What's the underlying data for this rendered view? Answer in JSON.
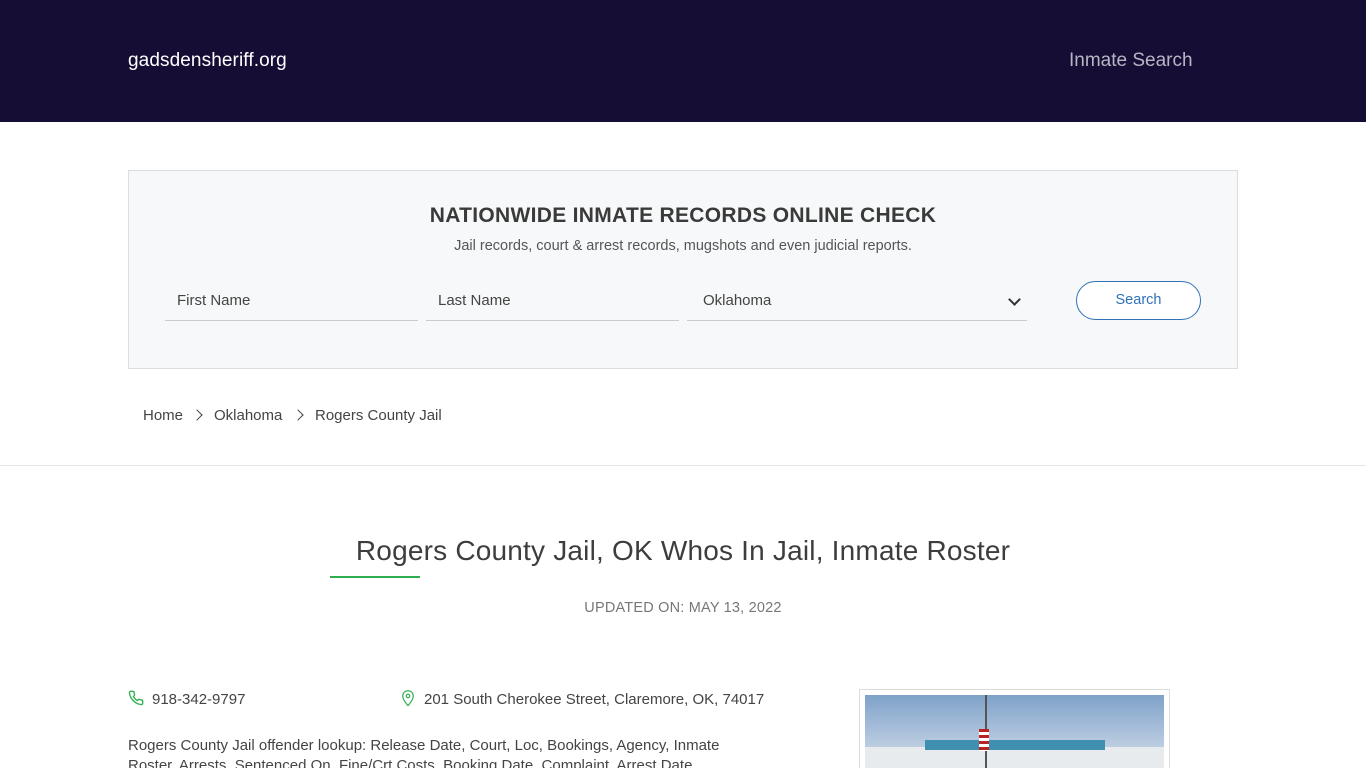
{
  "header": {
    "site_name": "gadsdensheriff.org",
    "nav_link": "Inmate Search",
    "background_color": "#150d34"
  },
  "search_panel": {
    "title": "NATIONWIDE INMATE RECORDS ONLINE CHECK",
    "subtitle": "Jail records, court & arrest records, mugshots and even judicial reports.",
    "first_name_placeholder": "First Name",
    "last_name_placeholder": "Last Name",
    "state_selected": "Oklahoma",
    "search_button": "Search",
    "accent_color": "#2f72b8"
  },
  "breadcrumb": {
    "items": [
      "Home",
      "Oklahoma",
      "Rogers County Jail"
    ]
  },
  "main": {
    "title": "Rogers County Jail, OK Whos In Jail, Inmate Roster",
    "updated": "UPDATED ON: MAY 13, 2022",
    "phone": "918-342-9797",
    "address": "201 South Cherokee Street, Claremore, OK, 74017",
    "description": "Rogers County Jail offender lookup: Release Date, Court, Loc, Bookings, Agency, Inmate Roster, Arrests, Sentenced On, Fine/Crt Costs, Booking Date, Complaint, Arrest Date",
    "rule_color": "#2eae4e",
    "icons": {
      "phone": "phone-icon",
      "location": "map-pin-icon"
    }
  }
}
